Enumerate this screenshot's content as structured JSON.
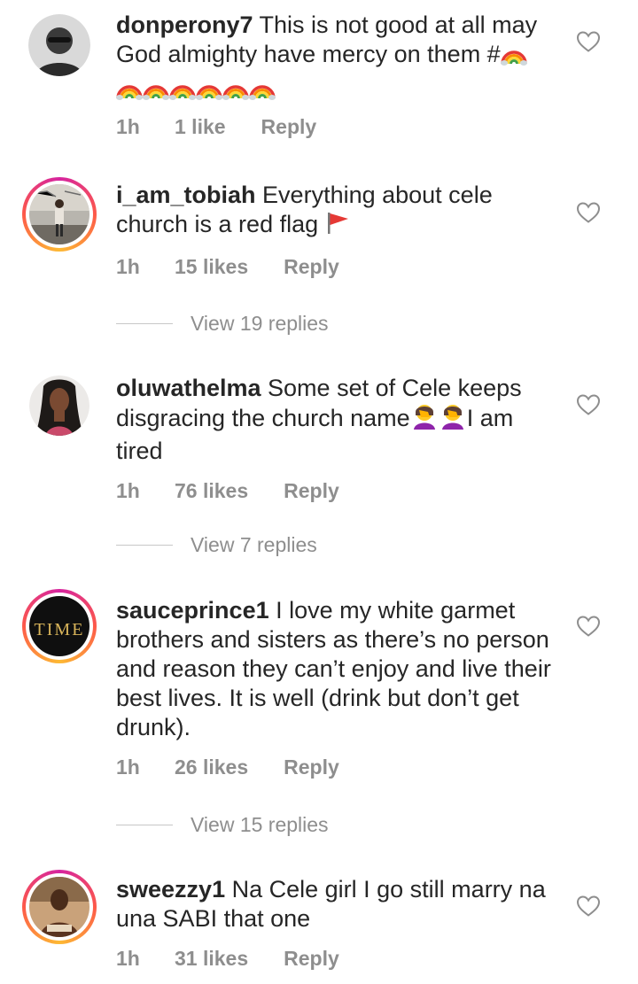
{
  "comments": [
    {
      "username": "donperony7",
      "text": " This is not good at all may God almighty have mercy on them #",
      "emoji_text": "",
      "time": "1h",
      "likes": "1 like",
      "reply": "Reply",
      "rainbows_inline": 1,
      "rainbows_line": 6
    },
    {
      "username": "i_am_tobiah",
      "text": " Everything about cele church is a red flag ",
      "time": "1h",
      "likes": "15 likes",
      "reply": "Reply",
      "view_replies": "View 19 replies"
    },
    {
      "username": "oluwathelma",
      "text": " Some set of Cele keeps disgracing the church name",
      "text_after": "I am tired",
      "time": "1h",
      "likes": "76 likes",
      "reply": "Reply",
      "view_replies": "View 7 replies"
    },
    {
      "username": "sauceprince1",
      "text": " I love my white garmet brothers and sisters as there’s no person and reason they can’t enjoy and live their best lives. It is well (drink but don’t get drunk).",
      "time": "1h",
      "likes": "26 likes",
      "reply": "Reply",
      "view_replies": "View 15 replies",
      "avatar_text": "TIME"
    },
    {
      "username": "sweezzy1",
      "text": " Na Cele girl I go still marry na una SABI that one",
      "time": "1h",
      "likes": "31 likes",
      "reply": "Reply"
    }
  ],
  "colors": {
    "text": "#262626",
    "meta": "#8e8e8e",
    "divider": "#c7c7c7",
    "story_ring_start": "#d6249f",
    "story_ring_end": "#fdb933"
  },
  "icons": {
    "like": "heart-outline-icon",
    "rainbow": "rainbow-emoji",
    "red_flag": "red-flag-emoji",
    "facepalm": "woman-facepalming-emoji"
  }
}
